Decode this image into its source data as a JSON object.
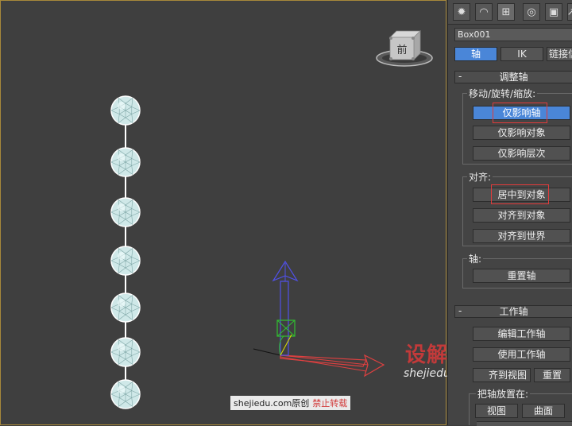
{
  "object_name": "Box001",
  "tabs": {
    "icons": [
      "sun-icon",
      "modify-arc-icon",
      "hierarchy-icon",
      "motion-icon",
      "display-icon",
      "utilities-icon"
    ],
    "sub": [
      "轴",
      "IK",
      "链接信"
    ]
  },
  "adjust_pivot": {
    "title": "调整轴",
    "collapse": "-",
    "move_group": "移动/旋转/缩放:",
    "affect_pivot_only": "仅影响轴",
    "affect_object_only": "仅影响对象",
    "affect_hierarchy_only": "仅影响层次",
    "align_group": "对齐:",
    "center_to_object": "居中到对象",
    "align_to_object": "对齐到对象",
    "align_to_world": "对齐到世界",
    "pivot_group": "轴:",
    "reset_pivot": "重置轴"
  },
  "working_pivot": {
    "title": "工作轴",
    "collapse": "-",
    "edit_working_pivot": "编辑工作轴",
    "use_working_pivot": "使用工作轴",
    "align_to_view": "齐到视图",
    "reset": "重置",
    "place_group": "把轴放置在:",
    "view": "视图",
    "surface": "曲面"
  },
  "viewcube_label": "前",
  "overlay": {
    "site": "shejiedu.com原创",
    "warning": "禁止转载"
  },
  "watermark": {
    "brand": "设解读",
    "url": "shejiedu.com"
  },
  "colors": {
    "active_blue": "#4a86d8",
    "highlight_red": "#e23b3b",
    "axis_x": "#e04040",
    "axis_y": "#4040e0",
    "axis_z": "#30c030"
  }
}
